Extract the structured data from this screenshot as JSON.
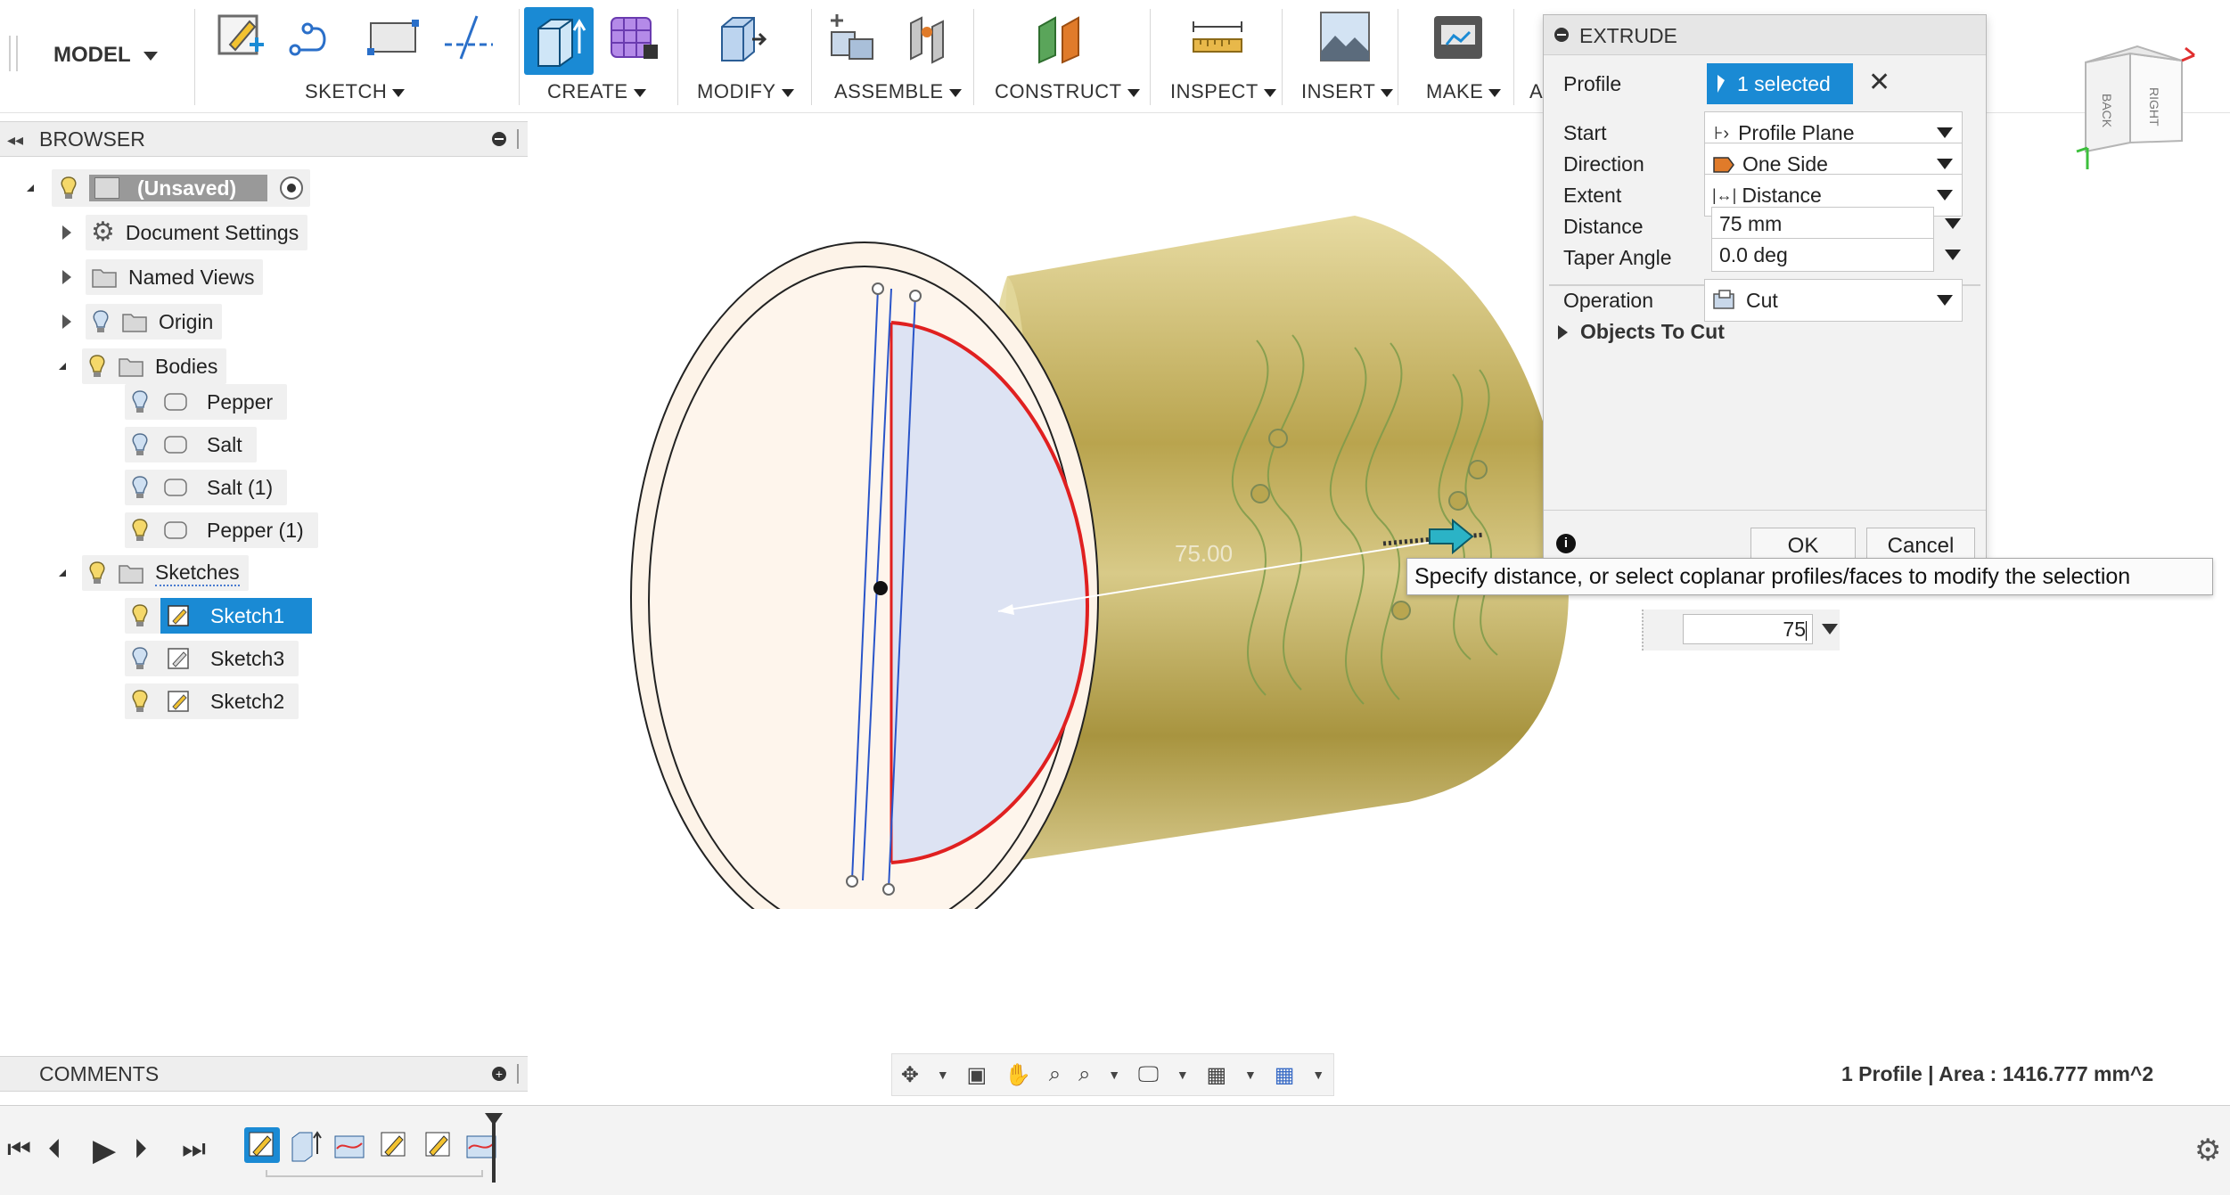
{
  "toolbar": {
    "model": "MODEL",
    "groups": {
      "sketch": "SKETCH",
      "create": "CREATE",
      "modify": "MODIFY",
      "assemble": "ASSEMBLE",
      "construct": "CONSTRUCT",
      "inspect": "INSPECT",
      "insert": "INSERT",
      "make": "MAKE",
      "overflow": "A"
    }
  },
  "browser": {
    "title": "BROWSER",
    "root": "(Unsaved)",
    "items": [
      {
        "label": "Document Settings"
      },
      {
        "label": "Named Views"
      },
      {
        "label": "Origin"
      },
      {
        "label": "Bodies"
      },
      {
        "label": "Pepper"
      },
      {
        "label": "Salt"
      },
      {
        "label": "Salt (1)"
      },
      {
        "label": "Pepper (1)"
      },
      {
        "label": "Sketches"
      },
      {
        "label": "Sketch1"
      },
      {
        "label": "Sketch3"
      },
      {
        "label": "Sketch2"
      }
    ]
  },
  "dialog": {
    "title": "EXTRUDE",
    "profile_label": "Profile",
    "profile_value": "1 selected",
    "start_label": "Start",
    "start_value": "Profile Plane",
    "direction_label": "Direction",
    "direction_value": "One Side",
    "extent_label": "Extent",
    "extent_value": "Distance",
    "distance_label": "Distance",
    "distance_value": "75 mm",
    "taper_label": "Taper Angle",
    "taper_value": "0.0 deg",
    "operation_label": "Operation",
    "operation_value": "Cut",
    "objects_to_cut": "Objects To Cut",
    "ok": "OK",
    "cancel": "Cancel"
  },
  "tooltip": "Specify distance, or select coplanar profiles/faces to modify the selection",
  "canvas": {
    "manipulator_value": "75",
    "dimension_label": "75.00"
  },
  "viewcube": {
    "faces": [
      "BACK",
      "RIGHT"
    ]
  },
  "comments": {
    "title": "COMMENTS"
  },
  "status": {
    "text": "1 Profile | Area : 1416.777 mm^2"
  },
  "colors": {
    "accent_blue": "#1a8ad4",
    "selection_red": "#e02020",
    "body_gold": "#d6c88a",
    "profile_face": "#fdf3e8"
  }
}
